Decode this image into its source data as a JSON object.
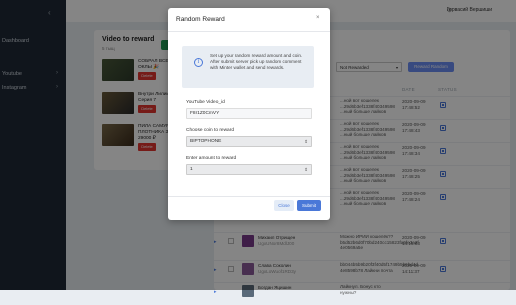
{
  "sidebar": {
    "items": [
      {
        "label": "Dashboard"
      },
      {
        "label": "Youtube"
      },
      {
        "label": "Instagram"
      }
    ]
  },
  "topbar": {
    "user_name": "Гервасий Вершиши"
  },
  "videos_card": {
    "title": "Video to reward",
    "subtitle": "5 тыщ",
    "delete_label": "Delete",
    "videos": [
      {
        "title": "СОБРАЛ ВСЕ",
        "title2": "ОКЛЫ 🎉"
      },
      {
        "title": "Внутри Лилии",
        "title2": "Серия 7"
      },
      {
        "title": "ПИЛА САМУР",
        "title2": "ПЛОТНИКА З",
        "title3": "29000 ₽"
      }
    ]
  },
  "comments_card": {
    "filter_value": "Not Rewarded",
    "random_button": "Reward Random",
    "headers": {
      "date": "DATE",
      "status": "STATUS"
    },
    "rows": [
      {
        "comment": "...ной вот кошелек",
        "comment2": "...29d6b3ef1338f40349598",
        "comment3": "...ный больше лайков",
        "date": "2020-09-09",
        "time": "17:48:52"
      },
      {
        "comment": "...ной вот кошелек",
        "comment2": "...29d6b3ef1338f40349598",
        "comment3": "...ный больше лайков",
        "date": "2020-09-09",
        "time": "17:48:43"
      },
      {
        "comment": "...ной вот кошелек",
        "comment2": "...29d6b3ef1338f40349598",
        "comment3": "...ный больше лайков",
        "date": "2020-09-09",
        "time": "17:48:34"
      },
      {
        "comment": "...ной вот кошелек",
        "comment2": "...29d6b3ef1338f40349598",
        "comment3": "...ный больше лайков",
        "date": "2020-09-09",
        "time": "17:48:25"
      },
      {
        "comment": "...ной вот кошелек",
        "comment2": "...29d6b3ef1338f40349598",
        "comment3": "...ный больше лайков",
        "date": "2020-09-09",
        "time": "17:48:24"
      },
      {
        "name": "Михаил Отрищен",
        "sub": "UgxUNor8MdlJ00",
        "comment": "Можно ИРИИ кошелёк??",
        "comment2": "b5d52b6d0f70bd240cc15823fa5fe3a2f",
        "comment3": "4e0569a5e",
        "date": "2020-09-09",
        "time": "14:15:03"
      },
      {
        "name": "Слава Соколин",
        "sub": "UgxLoWuof1RD3y",
        "comment": "bb044b5b9b20f3f40d5f1749b5b6bd4d",
        "comment2": "4e8598b78 Лайкни почта",
        "date": "2020-09-09",
        "time": "14:11:37"
      },
      {
        "name": "Богдан Яцишин",
        "sub": "",
        "comment": "Лайкнул. Бонус кто нужны?",
        "comment2": "",
        "date": "",
        "time": ""
      }
    ]
  },
  "modal": {
    "title": "Random Reward",
    "close_icon_glyph": "×",
    "info_text": "Set up your random reward amount and coin. After submit server pick up random comment with Minter wallet and send rewards.",
    "video_label": "YouTube Video_id",
    "video_value": "F8r1Z0CmVY",
    "coin_label": "Choose coin to reward",
    "coin_value": "BIPTOPHONE",
    "amount_label": "Enter amount to reward",
    "amount_value": "1",
    "close_button": "Close",
    "submit_button": "Submit"
  },
  "colors": {
    "accent": "#4a78d8",
    "danger": "#e3342f",
    "sidebar_bg": "#1f2937"
  }
}
